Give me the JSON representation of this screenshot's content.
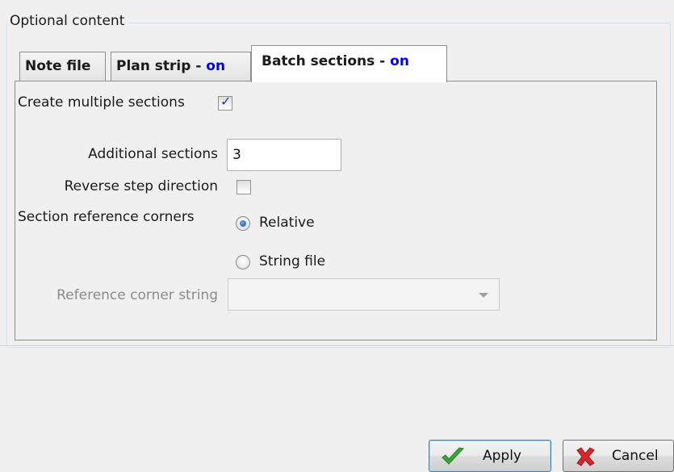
{
  "group": {
    "title": "Optional content"
  },
  "tabs": [
    {
      "name": "Note file",
      "status": ""
    },
    {
      "name": "Plan strip - ",
      "status": "on"
    },
    {
      "name": "Batch sections - ",
      "status": "on"
    }
  ],
  "batch_sections": {
    "create_multiple": {
      "label": "Create multiple sections",
      "checked": true
    },
    "additional_sections": {
      "label": "Additional sections",
      "value": "3"
    },
    "reverse_step": {
      "label": "Reverse step direction",
      "checked": false
    },
    "reference_corners": {
      "label": "Section reference corners",
      "options": [
        "Relative",
        "String file"
      ],
      "selected": "Relative"
    },
    "reference_corner_string": {
      "label": "Reference corner string",
      "value": ""
    }
  },
  "buttons": {
    "apply": "Apply",
    "cancel": "Cancel"
  },
  "icons": {
    "apply": "green-check-icon",
    "cancel": "red-x-icon",
    "checkbox_checked": "check-icon",
    "combo_arrow": "chevron-down-icon"
  },
  "colors": {
    "status_on": "#0000e6",
    "apply_icon": "#3aa53a",
    "cancel_icon": "#d9262b"
  }
}
